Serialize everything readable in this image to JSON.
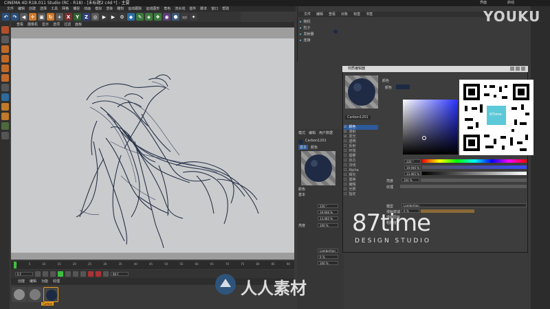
{
  "window": {
    "title": "CINEMA 4D R18.011 Studio (RC - R18) - [未标题2 c4d *] - 主要"
  },
  "top_right": {
    "app": "界面",
    "layout": "启动"
  },
  "watermarks": {
    "youku": "YOUKU",
    "brand": "87time",
    "brand_sub": "DESIGN STUDIO",
    "bottom": "人人素材"
  },
  "main_menu": [
    "文件",
    "编辑",
    "创建",
    "选择",
    "工具",
    "网格",
    "捕捉",
    "动画",
    "模拟",
    "渲染",
    "雕刻",
    "运动跟踪",
    "运动图形",
    "角色",
    "流水线",
    "插件",
    "脚本",
    "窗口",
    "帮助"
  ],
  "toolbar_labels": [
    "X",
    "Y",
    "Z"
  ],
  "viewport": {
    "menu": [
      "查看",
      "摄像机",
      "显示",
      "选项",
      "过滤",
      "面板"
    ]
  },
  "timeline": {
    "ticks": [
      "0",
      "5",
      "10",
      "15",
      "20",
      "25",
      "30",
      "35",
      "40",
      "45",
      "50",
      "55",
      "60",
      "65",
      "70",
      "75",
      "80",
      "85",
      "90"
    ],
    "start_frame": "0 F",
    "end_frame": "90 F",
    "current": "0 F"
  },
  "material_bar": {
    "menu": [
      "创建",
      "编辑",
      "功能",
      "纹理"
    ],
    "materials": [
      "Mat",
      "Mat",
      "Carbon"
    ]
  },
  "object_manager": {
    "menu": [
      "文件",
      "编辑",
      "查看",
      "对象",
      "标签",
      "书签"
    ],
    "objects": [
      "随机",
      "粒子",
      "发射器",
      "连接"
    ]
  },
  "attr_manager": {
    "menu": [
      "模式",
      "编辑",
      "用户数据"
    ],
    "material_name": "Carbon1201",
    "tabs": [
      "基本",
      "颜色"
    ],
    "label": "颜色",
    "section": "基本",
    "fields": [
      "226 °",
      "19.946 %",
      "13.465 %"
    ],
    "values": [
      "100 %",
      "0 %",
      "100 %"
    ],
    "model": "Lambertian",
    "label2": "亮度"
  },
  "mat_editor": {
    "title": "材质编辑器",
    "name": "Carbon1201",
    "section": "颜色",
    "color_label": "颜色",
    "channels": [
      "颜色",
      "漫射",
      "发光",
      "透明",
      "反射",
      "环境",
      "烟雾",
      "凹凸",
      "法线",
      "Alpha",
      "辉光",
      "置换",
      "编辑",
      "光照",
      "指定"
    ],
    "hsv": [
      "226 °",
      "19.946 %",
      "13.465 %"
    ],
    "brightness": "100 %",
    "texture": "纹理",
    "mix_mode": "标准",
    "mix_strength": "100 %",
    "model": "Lambertian",
    "diffuse": "漫射衰减",
    "diffuse_val": "0 %",
    "diffuse_level": "漫射层级",
    "roughness": "粗糙度"
  },
  "qr_text": "87time",
  "colors": {
    "accent": "#1d2a44",
    "hue_marker": "#ffffff"
  }
}
